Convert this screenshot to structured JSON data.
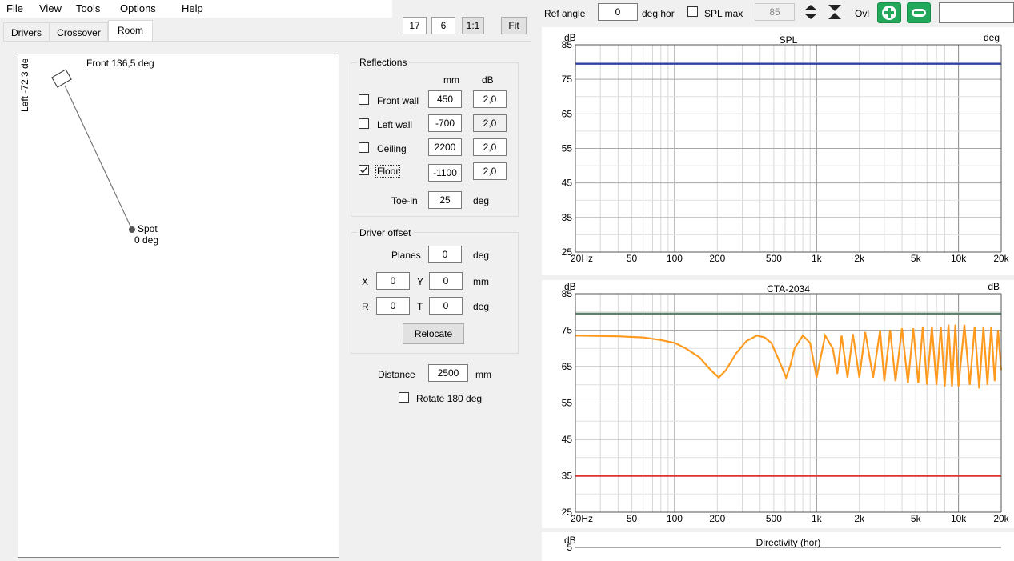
{
  "menu": [
    "File",
    "View",
    "Tools",
    "Options",
    "Help"
  ],
  "toolbar_left": {
    "value1": "17",
    "value2": "6",
    "one_to_one": "1:1",
    "fit": "Fit"
  },
  "toolbar_right": {
    "ref_angle_label": "Ref angle",
    "ref_angle_value": "0",
    "deg_hor_label": "deg hor",
    "spl_max_label": "SPL max",
    "spl_max_value": "85",
    "ovl_label": "Ovl"
  },
  "tabs": [
    "Drivers",
    "Crossover",
    "Room"
  ],
  "room": {
    "front_label": "Front 136,5 deg",
    "left_label": "Left -72,3 de",
    "spot_label": "Spot",
    "spot_deg": "0 deg"
  },
  "reflections": {
    "title": "Reflections",
    "col_mm": "mm",
    "col_db": "dB",
    "rows": [
      {
        "label": "Front wall",
        "checked": false,
        "mm": "450",
        "db": "2,0"
      },
      {
        "label": "Left wall",
        "checked": false,
        "mm": "-700",
        "db": "2,0"
      },
      {
        "label": "Ceiling",
        "checked": false,
        "mm": "2200",
        "db": "2,0"
      },
      {
        "label": "Floor",
        "checked": true,
        "mm": "-1100",
        "db": "2,0"
      }
    ],
    "toe_in_label": "Toe-in",
    "toe_in_value": "25",
    "toe_in_unit": "deg"
  },
  "driver_offset": {
    "title": "Driver offset",
    "planes_label": "Planes",
    "planes_value": "0",
    "planes_unit": "deg",
    "x_label": "X",
    "x_value": "0",
    "y_label": "Y",
    "y_value": "0",
    "xy_unit": "mm",
    "r_label": "R",
    "r_value": "0",
    "t_label": "T",
    "t_value": "0",
    "rt_unit": "deg",
    "relocate_label": "Relocate"
  },
  "distance": {
    "label": "Distance",
    "value": "2500",
    "unit": "mm"
  },
  "rotate": {
    "label": "Rotate 180 deg",
    "checked": false
  },
  "chart_data": [
    {
      "type": "line",
      "title": "SPL",
      "ylabel": "dB",
      "right_label": "deg",
      "ylim": [
        25,
        85
      ],
      "yticks": [
        "85",
        "75",
        "65",
        "55",
        "45",
        "35",
        "25"
      ],
      "xscale": "log",
      "xlim": [
        20,
        20000
      ],
      "xticks": [
        "20Hz",
        "50",
        "100",
        "200",
        "500",
        "1k",
        "2k",
        "5k",
        "10k",
        "20k"
      ],
      "series": [
        {
          "color": "#3040a0",
          "x": [
            20,
            20000
          ],
          "y": [
            79.5,
            79.5
          ]
        }
      ]
    },
    {
      "type": "line",
      "title": "CTA-2034",
      "ylabel": "dB",
      "right_label": "dB",
      "ylim": [
        25,
        85
      ],
      "yticks": [
        "85",
        "75",
        "65",
        "55",
        "45",
        "35",
        "25"
      ],
      "xscale": "log",
      "xlim": [
        20,
        20000
      ],
      "xticks": [
        "20Hz",
        "50",
        "100",
        "200",
        "500",
        "1k",
        "2k",
        "5k",
        "10k",
        "20k"
      ],
      "series": [
        {
          "color": "#5f7f6f",
          "x": [
            20,
            20000
          ],
          "y": [
            79.5,
            79.5
          ]
        },
        {
          "color": "#e03030",
          "x": [
            20,
            20000
          ],
          "y": [
            35,
            35
          ]
        },
        {
          "color": "#ff9a1e",
          "x": [
            20,
            40,
            60,
            80,
            100,
            120,
            150,
            180,
            205,
            230,
            270,
            320,
            380,
            430,
            480,
            540,
            610,
            650,
            700,
            800,
            900,
            1000,
            1050,
            1150,
            1300,
            1400,
            1500,
            1650,
            1800,
            2000,
            2200,
            2500,
            2800,
            3000,
            3300,
            3600,
            4000,
            4400,
            4800,
            5200,
            5600,
            6000,
            6500,
            7000,
            7500,
            8000,
            8500,
            9000,
            9500,
            10000,
            11000,
            12000,
            13000,
            14000,
            15000,
            16000,
            17000,
            18000,
            19000,
            20000
          ],
          "y": [
            73.5,
            73.3,
            73,
            72.3,
            71.5,
            70,
            67.5,
            64,
            62,
            64,
            68.5,
            72,
            73.5,
            73,
            71.5,
            67,
            62,
            65,
            70,
            73.5,
            71.5,
            62,
            66,
            73.5,
            70,
            63,
            73.5,
            62,
            74,
            62,
            74.5,
            62,
            75,
            61,
            75,
            61,
            75.5,
            60.5,
            75.5,
            60.5,
            76,
            60,
            76,
            60,
            76,
            59.5,
            76.5,
            59.5,
            76.5,
            59.5,
            76.5,
            60,
            76,
            59,
            76,
            60,
            76,
            61,
            75,
            64
          ]
        }
      ]
    },
    {
      "type": "line",
      "title": "Directivity (hor)",
      "ylabel": "dB",
      "yticks": [
        "5"
      ],
      "xscale": "log",
      "xlim": [
        20,
        20000
      ]
    }
  ]
}
